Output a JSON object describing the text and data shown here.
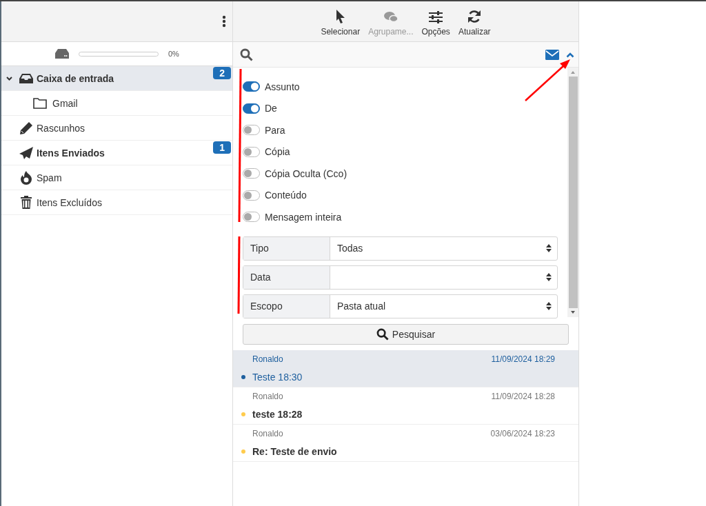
{
  "storage": {
    "level": 0,
    "reading": "0%"
  },
  "folders": [
    {
      "label": "Caixa de entrada",
      "selected": true,
      "unread": true,
      "badge": "2",
      "expanded": true,
      "children": [
        {
          "label": "Gmail",
          "selected": false,
          "unread": false
        }
      ]
    },
    {
      "label": "Rascunhos",
      "selected": false,
      "unread": false
    },
    {
      "label": "Itens Enviados",
      "selected": false,
      "unread": true,
      "badge": "1"
    },
    {
      "label": "Spam",
      "selected": false,
      "unread": false
    },
    {
      "label": "Itens Excluídos",
      "selected": false,
      "unread": false
    }
  ],
  "toolbar": [
    {
      "label": "Selecionar",
      "disabled": false
    },
    {
      "label": "Agrupame...",
      "disabled": true
    },
    {
      "label": "Opções",
      "disabled": false
    },
    {
      "label": "Atualizar",
      "disabled": false
    }
  ],
  "filters": [
    {
      "label": "Assunto",
      "on": true
    },
    {
      "label": "De",
      "on": true
    },
    {
      "label": "Para",
      "on": false
    },
    {
      "label": "Cópia",
      "on": false
    },
    {
      "label": "Cópia Oculta (Cco)",
      "on": false
    },
    {
      "label": "Conteúdo",
      "on": false
    },
    {
      "label": "Mensagem inteira",
      "on": false
    }
  ],
  "selects": [
    {
      "label": "Tipo",
      "value": "Todas"
    },
    {
      "label": "Data"
    },
    {
      "label": "Escopo",
      "value": "Pasta atual"
    }
  ],
  "search_button": "Pesquisar",
  "messages": [
    {
      "sender": "Ronaldo",
      "date": "11/09/2024 18:29",
      "subject": "Teste 18:30",
      "selected": true,
      "unread": false
    },
    {
      "sender": "Ronaldo",
      "date": "11/09/2024 18:28",
      "subject": "teste 18:28",
      "selected": false,
      "unread": true
    },
    {
      "sender": "Ronaldo",
      "date": "03/06/2024 18:23",
      "subject": "Re: Teste de envio",
      "selected": false,
      "unread": true
    }
  ]
}
